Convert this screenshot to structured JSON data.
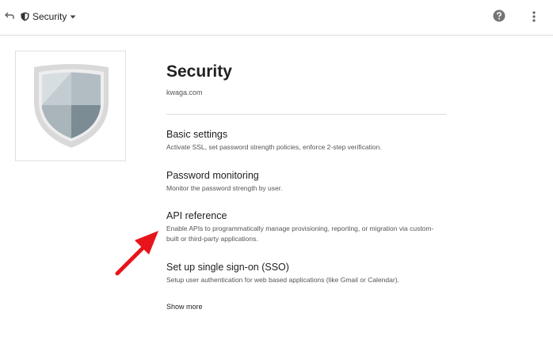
{
  "header": {
    "breadcrumb_label": "Security",
    "icons": {
      "back": "back-arrow-icon",
      "section": "shield-icon",
      "dropdown": "caret-down-icon",
      "help": "help-icon",
      "menu": "more-vert-icon"
    }
  },
  "page": {
    "title": "Security",
    "domain": "kwaga.com"
  },
  "settings": [
    {
      "title": "Basic settings",
      "description": "Activate SSL, set password strength policies, enforce 2-step verification."
    },
    {
      "title": "Password monitoring",
      "description": "Monitor the password strength by user."
    },
    {
      "title": "API reference",
      "description": "Enable APIs to programmatically manage provisioning, reporting, or migration via custom-built or third-party applications."
    },
    {
      "title": "Set up single sign-on (SSO)",
      "description": "Setup user authentication for web based applications (like Gmail or Calendar)."
    }
  ],
  "show_more_label": "Show more",
  "colors": {
    "annotation_arrow": "#e8141b",
    "shield_rim": "#d9d9d9",
    "shield_dark": "#8f9ea6",
    "shield_light": "#c3ccd1"
  }
}
